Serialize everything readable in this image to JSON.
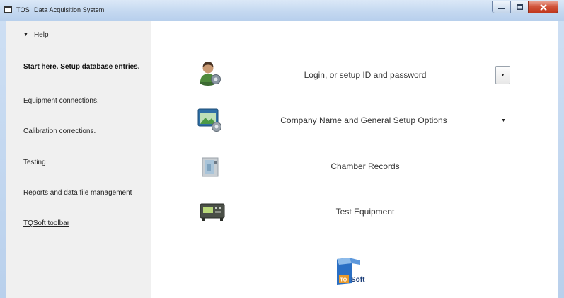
{
  "window": {
    "app_name": "TQS",
    "title": "Data Acquisition System"
  },
  "sidebar": {
    "help_label": "Help",
    "items": [
      {
        "label": "Start here. Setup database entries."
      },
      {
        "label": "Equipment connections."
      },
      {
        "label": "Calibration corrections."
      },
      {
        "label": "Testing"
      },
      {
        "label": "Reports and data file management"
      },
      {
        "label": "TQSoft toolbar"
      }
    ]
  },
  "main": {
    "rows": [
      {
        "label": "Login, or setup ID and password",
        "icon": "user-icon"
      },
      {
        "label": "Company Name and General Setup Options",
        "icon": "settings-window-icon"
      },
      {
        "label": "Chamber Records",
        "icon": "chamber-icon"
      },
      {
        "label": "Test Equipment",
        "icon": "meter-icon"
      }
    ],
    "logo_text": "Soft",
    "logo_mark": "TQ"
  },
  "colors": {
    "titlebar": "#c4d8f0",
    "sidebar": "#f0f0f0",
    "close_button": "#c0361c",
    "logo_blue": "#2a6fc4"
  }
}
